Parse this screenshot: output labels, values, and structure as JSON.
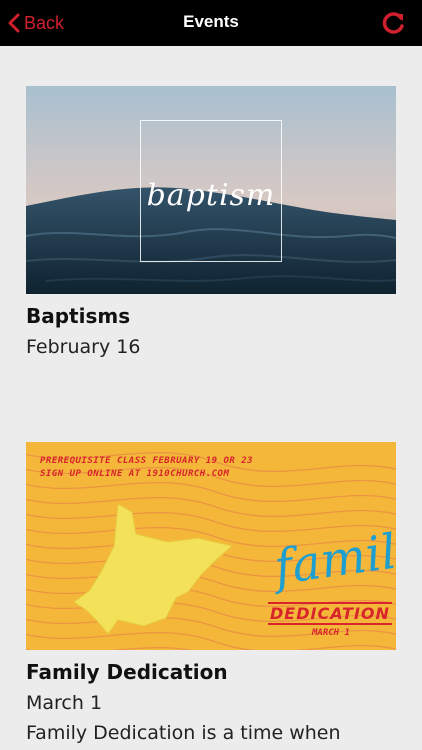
{
  "nav": {
    "back_label": "Back",
    "title": "Events"
  },
  "events": [
    {
      "banner_text": "baptism",
      "title": "Baptisms",
      "date": "February 16"
    },
    {
      "banner_lines": [
        "PREREQUISITE CLASS FEBRUARY 19 OR 23",
        "SIGN UP ONLINE AT 1910CHURCH.COM"
      ],
      "banner_script": "family",
      "banner_heading": "DEDICATION",
      "banner_date": "MARCH 1",
      "title": "Family Dedication",
      "date": "March 1",
      "description": "Family Dedication is a time when"
    }
  ],
  "colors": {
    "accent": "#d0202e",
    "navbar": "#000000",
    "background": "#ececec",
    "banner_yellow": "#f4b73a",
    "banner_blue": "#1e9fd0"
  }
}
